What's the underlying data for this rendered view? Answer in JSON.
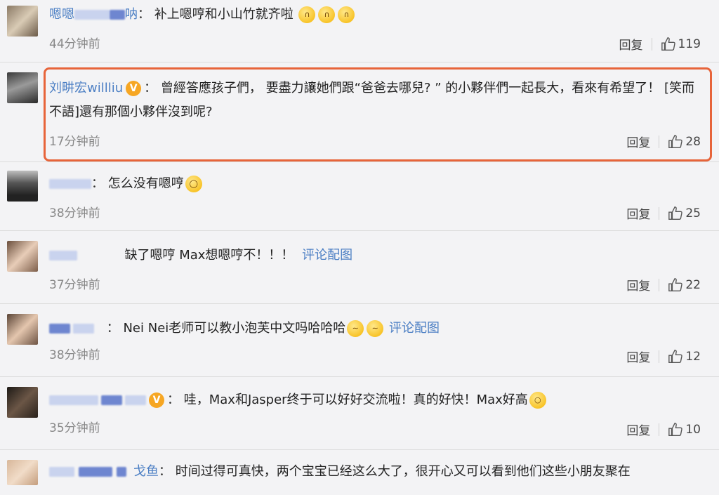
{
  "comments": [
    {
      "user_visible": "嗯嗯",
      "user_suffix": "呐",
      "text": "补上嗯哼和小山竹就齐啦",
      "emoji_count": 3,
      "time": "44分钟前",
      "reply_label": "回复",
      "likes": "119"
    },
    {
      "user": "刘畊宏willliu",
      "verified": true,
      "text": "曾經答應孩子們， 要盡力讓她們跟“爸爸去哪兒? ” 的小夥伴們一起長大，看來有希望了！ [笑而不語]還有那個小夥伴沒到呢?",
      "time": "17分钟前",
      "reply_label": "回复",
      "likes": "28"
    },
    {
      "text": "怎么没有嗯哼",
      "time": "38分钟前",
      "reply_label": "回复",
      "likes": "25"
    },
    {
      "text": "缺了嗯哼 Max想嗯哼不！！！",
      "link": "评论配图",
      "time": "37分钟前",
      "reply_label": "回复",
      "likes": "22"
    },
    {
      "text": "Nei Nei老师可以教小泡芙中文吗哈哈哈",
      "link": "评论配图",
      "time": "38分钟前",
      "reply_label": "回复",
      "likes": "12"
    },
    {
      "verified": true,
      "text": "哇，Max和Jasper终于可以好好交流啦！真的好快！Max好高",
      "time": "35分钟前",
      "reply_label": "回复",
      "likes": "10"
    },
    {
      "user_suffix": "戈鱼",
      "text": "时间过得可真快，两个宝宝已经这么大了，很开心又可以看到他们这些小朋友聚在"
    }
  ],
  "colors": {
    "username": "#4c7fc4",
    "highlight_border": "#e7643a",
    "verified_badge": "#f6a623",
    "background": "#f3f3f5"
  },
  "icons": {
    "like": "thumbs-up-icon",
    "verified": "verified-v-icon",
    "emoji": "emoji-face-icon"
  },
  "verified_glyph": "V",
  "colon": "："
}
